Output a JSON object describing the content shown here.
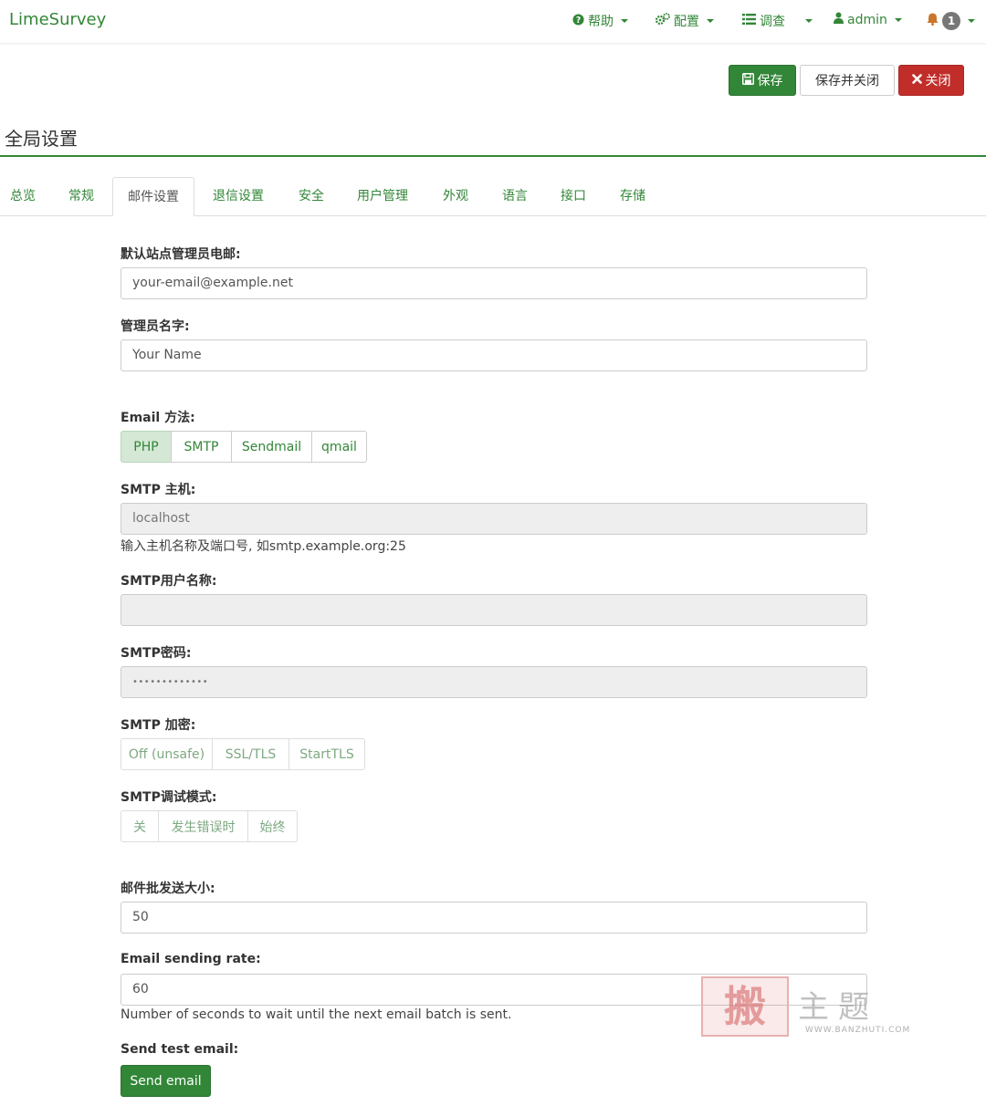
{
  "brand": "LimeSurvey",
  "nav": {
    "help": "帮助",
    "config": "配置",
    "surveys": "调查",
    "user": "admin",
    "notifications_count": "1"
  },
  "actions": {
    "save": "保存",
    "save_close": "保存并关闭",
    "close": "关闭"
  },
  "page_title": "全局设置",
  "tabs": [
    "总览",
    "常规",
    "邮件设置",
    "退信设置",
    "安全",
    "用户管理",
    "外观",
    "语言",
    "接口",
    "存储"
  ],
  "active_tab": "邮件设置",
  "form": {
    "admin_email_label": "默认站点管理员电邮:",
    "admin_email_value": "your-email@example.net",
    "admin_name_label": "管理员名字:",
    "admin_name_value": "Your Name",
    "email_method_label": "Email 方法:",
    "email_methods": [
      "PHP",
      "SMTP",
      "Sendmail",
      "qmail"
    ],
    "email_method_selected": "PHP",
    "smtp_host_label": "SMTP 主机:",
    "smtp_host_value": "localhost",
    "smtp_host_help": "输入主机名称及端口号, 如smtp.example.org:25",
    "smtp_user_label": "SMTP用户名称:",
    "smtp_user_value": "",
    "smtp_password_label": "SMTP密码:",
    "smtp_password_value": "•••••••••••••",
    "smtp_encryption_label": "SMTP 加密:",
    "smtp_encryption_options": [
      "Off (unsafe)",
      "SSL/TLS",
      "StartTLS"
    ],
    "smtp_debug_label": "SMTP调试模式:",
    "smtp_debug_options": [
      "关",
      "发生错误时",
      "始终"
    ],
    "batch_size_label": "邮件批发送大小:",
    "batch_size_value": "50",
    "sending_rate_label": "Email sending rate:",
    "sending_rate_value": "60",
    "sending_rate_help": "Number of seconds to wait until the next email batch is sent.",
    "test_email_label": "Send test email:",
    "send_button": "Send email"
  },
  "watermark": {
    "logo_char": "搬",
    "text": "主题",
    "url": "WWW.BANZHUTI.COM"
  },
  "colors": {
    "primary": "#328637",
    "danger": "#c12e2a",
    "active_toggle": "#d4e8d5"
  }
}
